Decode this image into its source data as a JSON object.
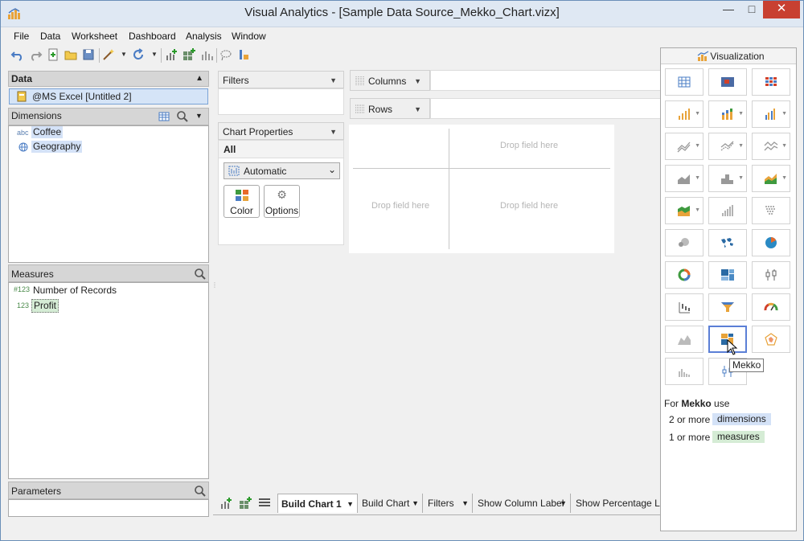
{
  "window": {
    "title": "Visual Analytics - [Sample Data Source_Mekko_Chart.vizx]"
  },
  "menu": [
    "File",
    "Data",
    "Worksheet",
    "Dashboard",
    "Analysis",
    "Window"
  ],
  "data_panel": {
    "header": "Data",
    "datasource": "@MS Excel [Untitled 2]",
    "dimensions_header": "Dimensions",
    "dimensions": [
      {
        "icon": "abc",
        "label": "Coffee"
      },
      {
        "icon": "globe",
        "label": "Geography"
      }
    ],
    "measures_header": "Measures",
    "measures": [
      {
        "icon": "#123",
        "label": "Number of Records"
      },
      {
        "icon": "123",
        "label": "Profit"
      }
    ],
    "parameters_header": "Parameters"
  },
  "filters": {
    "title": "Filters"
  },
  "chart_properties": {
    "title": "Chart Properties",
    "scope": "All",
    "mark_type": "Automatic",
    "color_label": "Color",
    "options_label": "Options"
  },
  "shelves": {
    "columns": "Columns",
    "rows": "Rows"
  },
  "drop_area": {
    "top_right": "Drop field here",
    "bottom_left": "Drop field here",
    "bottom_right": "Drop field here"
  },
  "visualization": {
    "header": "Visualization",
    "tooltip": "Mekko",
    "hint_prefix": "For",
    "hint_chart": "Mekko",
    "hint_suffix": "use",
    "req_dims_count": "2 or more",
    "req_dims_label": "dimensions",
    "req_meas_count": "1 or more",
    "req_meas_label": "measures"
  },
  "tabs": [
    "Build Chart 1",
    "Build Chart",
    "Filters",
    "Show Column Label",
    "Show Percentage Lab"
  ],
  "colors": {
    "accent": "#5b7fd6",
    "dim_bg": "#d4e2f7",
    "meas_bg": "#d5ecd5",
    "close": "#c84031"
  }
}
